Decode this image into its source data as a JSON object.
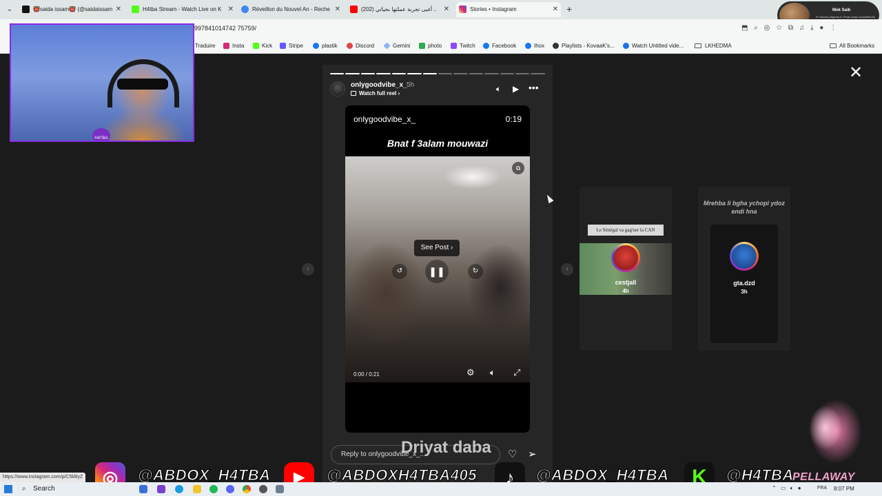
{
  "browser": {
    "tabs": [
      {
        "label": "👹saida issam👹 (@saidaissam",
        "favicon_color": "#111111"
      },
      {
        "label": "H4tba Stream - Watch Live on K",
        "favicon_color": "#53fc18"
      },
      {
        "label": "Réveillon du Nouvel An - Reche",
        "favicon_color": "#4285f4"
      },
      {
        "label": "(202) أغبى تجربة عملتها بحياتي ..",
        "favicon_color": "#ff0000"
      },
      {
        "label": "Stories • Instagram",
        "favicon_color": "#d62976"
      }
    ],
    "active_tab_index": 4,
    "url": "997841014742 75759/",
    "profile_popup": {
      "name": "Mok Saib",
      "subtitle": "El Oborba (Algeria) ft. Photo Isaac &Zaaf&Radio"
    },
    "bookmarks": [
      {
        "label": "Traduire",
        "color": "#4285f4"
      },
      {
        "label": "Insta",
        "color": "#d62976"
      },
      {
        "label": "Kick",
        "color": "#53fc18"
      },
      {
        "label": "Stripe",
        "color": "#635bff"
      },
      {
        "label": "plastik",
        "color": "#1877f2"
      },
      {
        "label": "Discord",
        "color": "#5865f2"
      },
      {
        "label": "Gemini",
        "color": "#8ab4f8"
      },
      {
        "label": "photo",
        "color": "#34a853"
      },
      {
        "label": "Twitch",
        "color": "#9146ff"
      },
      {
        "label": "Facebook",
        "color": "#1877f2"
      },
      {
        "label": "Ihox",
        "color": "#1877f2"
      },
      {
        "label": "Playlists - KovaaK's...",
        "color": "#333333"
      },
      {
        "label": "Watch Untitled vide...",
        "color": "#1a73e8"
      },
      {
        "label": "LKHEDMA",
        "color": "#555555"
      }
    ],
    "all_bookmarks_label": "All Bookmarks",
    "status_url": "https://www.instagram.com/p/C5kByZ"
  },
  "story": {
    "progress_total": 14,
    "progress_done": 7,
    "username": "onlygoodvibe_x_",
    "time_ago": "5h",
    "watch_full_reel": "Watch full reel",
    "card": {
      "username": "onlygoodvibe_x_",
      "duration": "0:19",
      "title": "Bnat f 3alam mouwazi",
      "see_post": "See Post",
      "current_time": "0:00",
      "separator": "/",
      "total_time": "0:21"
    },
    "reply_placeholder": "Reply to onlygoodvibe_x_...",
    "overlay_caption": "Driyat daba"
  },
  "previews": [
    {
      "caption": "Le Sénégal va gag'ner la CAN",
      "name": "cestjall",
      "ago": "4h"
    },
    {
      "text": "Mrehba li bgha ychopi ydoz endi hna",
      "name": "gta.dzd",
      "ago": "3h"
    }
  ],
  "stream_banner": {
    "instagram": "@ABDOX_H4TBA",
    "youtube": "@ABDOXH4TBA405",
    "tiktok": "@ABDOX_H4TBA",
    "kick": "@H4TBA",
    "brand": "PELLAWAY",
    "webcam_logo": "H4TBA"
  },
  "taskbar": {
    "search_label": "Search",
    "language": "FRA",
    "clock": "8:07 PM"
  }
}
